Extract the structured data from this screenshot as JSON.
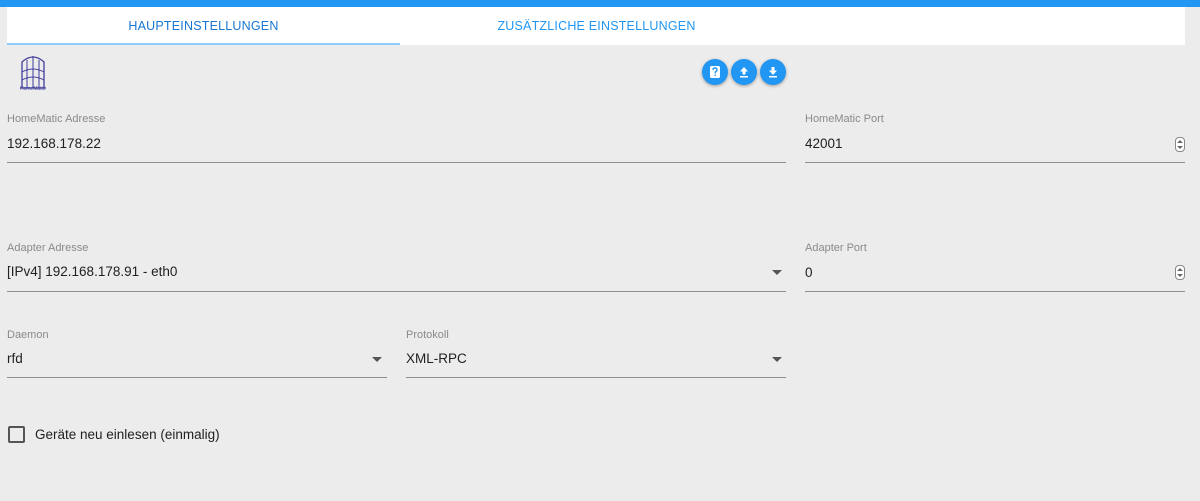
{
  "tabs": [
    {
      "label": "HAUPTEINSTELLUNGEN",
      "active": true
    },
    {
      "label": "ZUSÄTZLICHE EINSTELLUNGEN",
      "active": false
    }
  ],
  "logo": {
    "text": "HomeMatic"
  },
  "toolbar": {
    "icons": [
      "help-icon",
      "upload-icon",
      "download-icon"
    ]
  },
  "fields": {
    "homematic_address": {
      "label": "HomeMatic Adresse",
      "value": "192.168.178.22"
    },
    "homematic_port": {
      "label": "HomeMatic Port",
      "value": "42001"
    },
    "adapter_address": {
      "label": "Adapter Adresse",
      "value": "[IPv4] 192.168.178.91 - eth0"
    },
    "adapter_port": {
      "label": "Adapter Port",
      "value": "0"
    },
    "daemon": {
      "label": "Daemon",
      "value": "rfd"
    },
    "protocol": {
      "label": "Protokoll",
      "value": "XML-RPC"
    }
  },
  "checkbox": {
    "label": "Geräte neu einlesen (einmalig)",
    "checked": false
  },
  "colors": {
    "accent": "#2196f3",
    "background": "#ececec"
  }
}
